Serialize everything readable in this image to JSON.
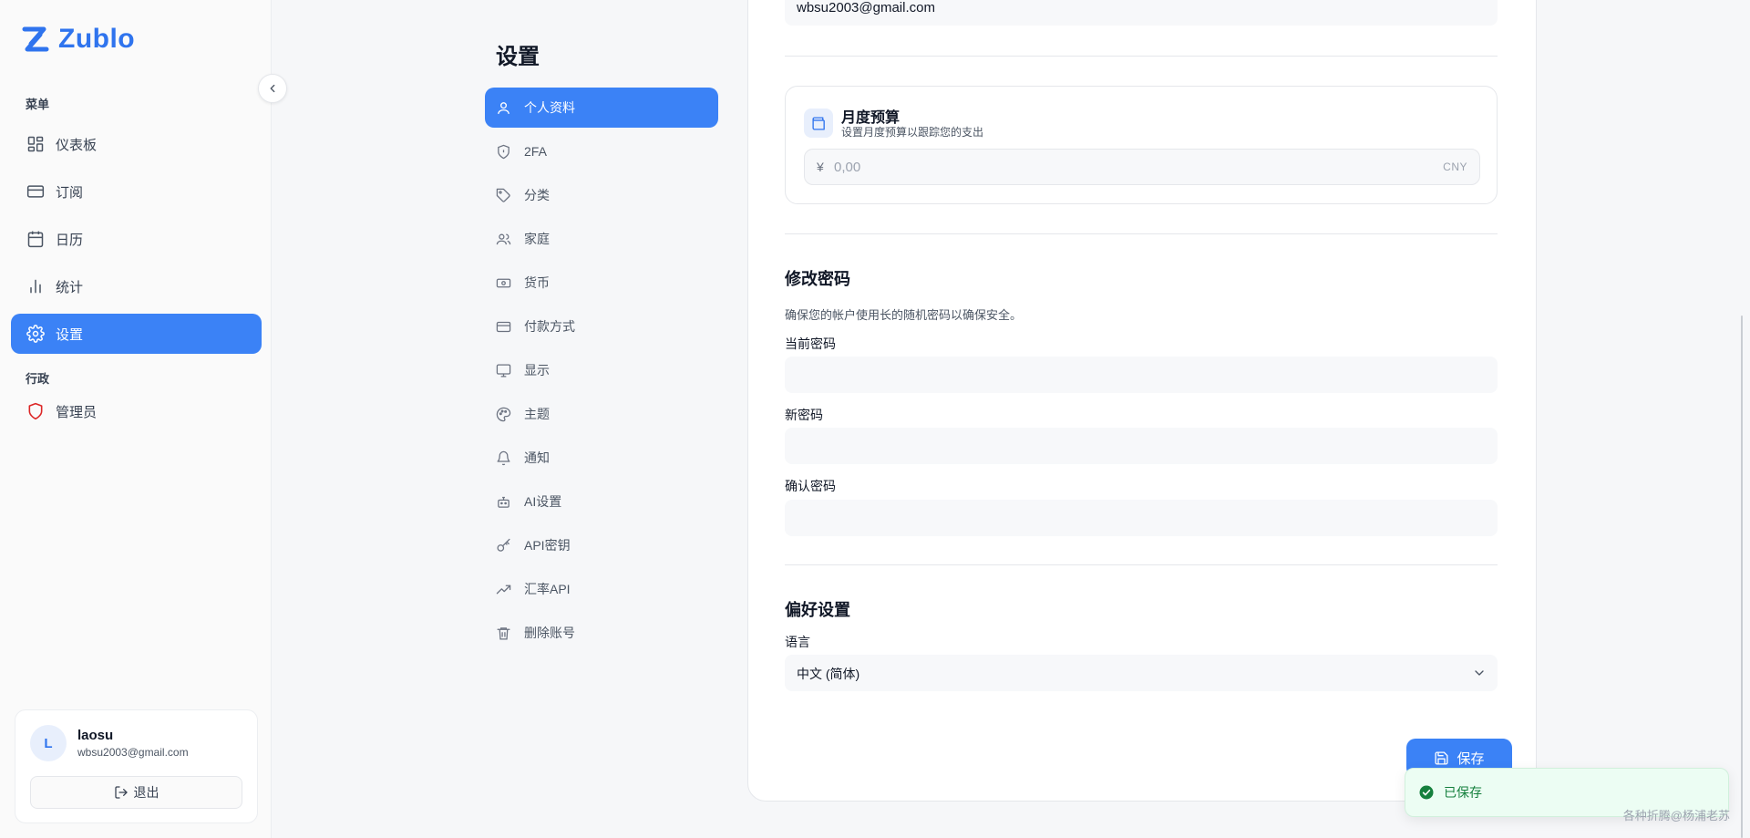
{
  "app": {
    "brand": "Zublo",
    "accent": "#3b82f6",
    "brand_color": "#2f74ee"
  },
  "sidebar": {
    "menu_label": "菜单",
    "items": [
      {
        "label": "仪表板",
        "icon": "dashboard-icon"
      },
      {
        "label": "订阅",
        "icon": "card-icon"
      },
      {
        "label": "日历",
        "icon": "calendar-icon"
      },
      {
        "label": "统计",
        "icon": "bar-chart-icon"
      },
      {
        "label": "设置",
        "icon": "gear-icon",
        "active": true
      }
    ],
    "admin_label": "行政",
    "admin_item": {
      "label": "管理员",
      "icon": "shield-icon"
    },
    "user": {
      "initial": "L",
      "name": "laosu",
      "email": "wbsu2003@gmail.com",
      "logout": "退出"
    }
  },
  "settings_nav": {
    "title": "设置",
    "items": [
      {
        "label": "个人资料",
        "icon": "user-icon",
        "active": true
      },
      {
        "label": "2FA",
        "icon": "shield-icon"
      },
      {
        "label": "分类",
        "icon": "tag-icon"
      },
      {
        "label": "家庭",
        "icon": "users-icon"
      },
      {
        "label": "货币",
        "icon": "banknote-icon"
      },
      {
        "label": "付款方式",
        "icon": "credit-card-icon"
      },
      {
        "label": "显示",
        "icon": "monitor-icon"
      },
      {
        "label": "主题",
        "icon": "palette-icon"
      },
      {
        "label": "通知",
        "icon": "bell-icon"
      },
      {
        "label": "AI设置",
        "icon": "bot-icon"
      },
      {
        "label": "API密钥",
        "icon": "key-icon"
      },
      {
        "label": "汇率API",
        "icon": "trending-up-icon"
      },
      {
        "label": "删除账号",
        "icon": "trash-icon"
      }
    ]
  },
  "profile": {
    "email_value": "wbsu2003@gmail.com"
  },
  "budget": {
    "title": "月度预算",
    "subtitle": "设置月度预算以跟踪您的支出",
    "currency_symbol": "¥",
    "placeholder": "0,00",
    "currency_code": "CNY"
  },
  "password": {
    "title": "修改密码",
    "description": "确保您的帐户使用长的随机密码以确保安全。",
    "current_label": "当前密码",
    "new_label": "新密码",
    "confirm_label": "确认密码"
  },
  "preferences": {
    "title": "偏好设置",
    "language_label": "语言",
    "language_value": "中文 (简体)"
  },
  "actions": {
    "save": "保存"
  },
  "toast": {
    "message": "已保存",
    "color": "#15803d"
  },
  "watermark": "各种折腾@杨浦老苏"
}
